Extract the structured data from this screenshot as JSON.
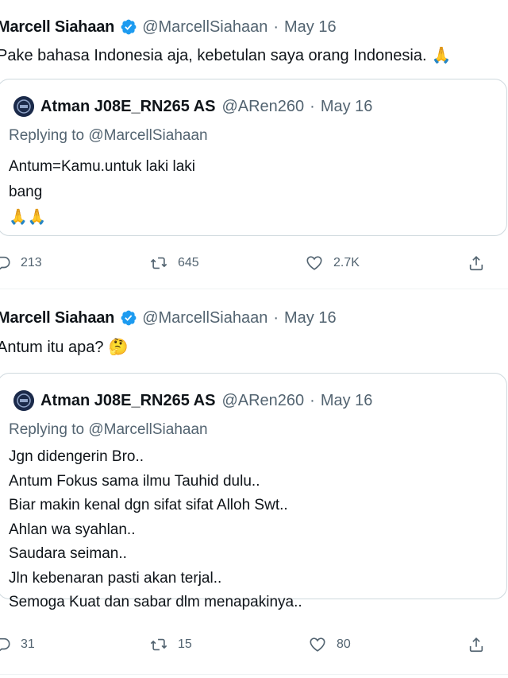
{
  "tweets": [
    {
      "author_name": "Marcell Siahaan",
      "handle": "@MarcellSiahaan",
      "separator": "·",
      "date": "May 16",
      "text": "Pake bahasa Indonesia aja, kebetulan saya orang Indonesia.",
      "text_emoji": "🙏",
      "quote": {
        "author_name": "Atman J08E_RN265 AS",
        "handle": "@ARen260",
        "separator": "·",
        "date": "May 16",
        "replying_to": "Replying to @MarcellSiahaan",
        "lines": [
          "Antum=Kamu.untuk laki laki",
          "bang",
          "🙏🙏"
        ]
      },
      "actions": {
        "replies": "213",
        "retweets": "645",
        "likes": "2.7K"
      }
    },
    {
      "author_name": "Marcell Siahaan",
      "handle": "@MarcellSiahaan",
      "separator": "·",
      "date": "May 16",
      "text": "Antum itu apa?",
      "text_emoji": "🤔",
      "quote": {
        "author_name": "Atman J08E_RN265 AS",
        "handle": "@ARen260",
        "separator": "·",
        "date": "May 16",
        "replying_to": "Replying to @MarcellSiahaan",
        "lines": [
          "Jgn didengerin Bro..",
          "Antum Fokus sama ilmu Tauhid dulu..",
          "Biar makin kenal dgn sifat sifat  Alloh Swt..",
          "Ahlan wa syahlan..",
          "Saudara seiman..",
          "Jln kebenaran pasti akan terjal..",
          "Semoga Kuat dan sabar dlm menapakinya.."
        ]
      },
      "actions": {
        "replies": "31",
        "retweets": "15",
        "likes": "80"
      }
    }
  ],
  "icons": {
    "verified": "verified-badge-icon",
    "reply": "reply-icon",
    "retweet": "retweet-icon",
    "like": "heart-icon",
    "share": "share-icon"
  },
  "colors": {
    "verified_blue": "#1d9bf0",
    "secondary_text": "#536471",
    "border": "#cfd9de",
    "avatar_bg": "#1b2a4a"
  }
}
